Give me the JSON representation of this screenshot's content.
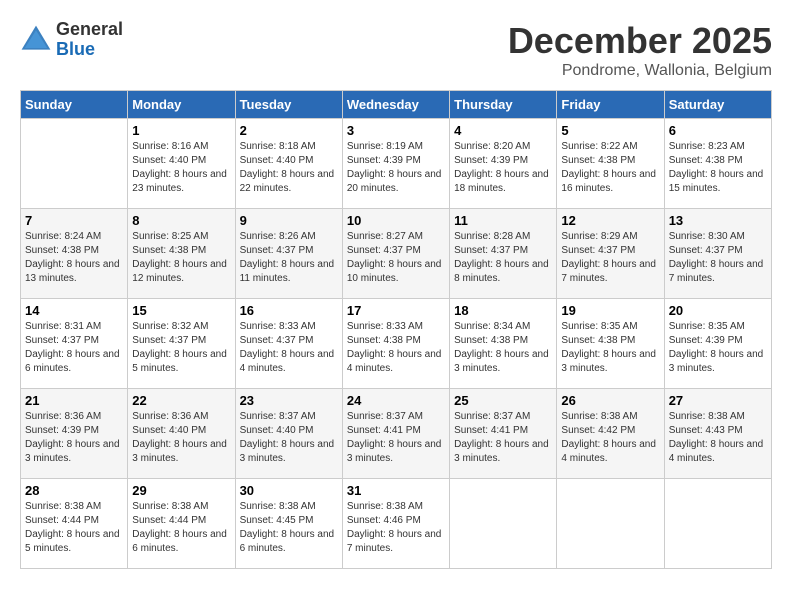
{
  "logo": {
    "general": "General",
    "blue": "Blue"
  },
  "title": {
    "month": "December 2025",
    "location": "Pondrome, Wallonia, Belgium"
  },
  "weekdays": [
    "Sunday",
    "Monday",
    "Tuesday",
    "Wednesday",
    "Thursday",
    "Friday",
    "Saturday"
  ],
  "weeks": [
    [
      {
        "day": "",
        "empty": true
      },
      {
        "day": "1",
        "sunrise": "8:16 AM",
        "sunset": "4:40 PM",
        "daylight": "8 hours and 23 minutes."
      },
      {
        "day": "2",
        "sunrise": "8:18 AM",
        "sunset": "4:40 PM",
        "daylight": "8 hours and 22 minutes."
      },
      {
        "day": "3",
        "sunrise": "8:19 AM",
        "sunset": "4:39 PM",
        "daylight": "8 hours and 20 minutes."
      },
      {
        "day": "4",
        "sunrise": "8:20 AM",
        "sunset": "4:39 PM",
        "daylight": "8 hours and 18 minutes."
      },
      {
        "day": "5",
        "sunrise": "8:22 AM",
        "sunset": "4:38 PM",
        "daylight": "8 hours and 16 minutes."
      },
      {
        "day": "6",
        "sunrise": "8:23 AM",
        "sunset": "4:38 PM",
        "daylight": "8 hours and 15 minutes."
      }
    ],
    [
      {
        "day": "7",
        "sunrise": "8:24 AM",
        "sunset": "4:38 PM",
        "daylight": "8 hours and 13 minutes."
      },
      {
        "day": "8",
        "sunrise": "8:25 AM",
        "sunset": "4:38 PM",
        "daylight": "8 hours and 12 minutes."
      },
      {
        "day": "9",
        "sunrise": "8:26 AM",
        "sunset": "4:37 PM",
        "daylight": "8 hours and 11 minutes."
      },
      {
        "day": "10",
        "sunrise": "8:27 AM",
        "sunset": "4:37 PM",
        "daylight": "8 hours and 10 minutes."
      },
      {
        "day": "11",
        "sunrise": "8:28 AM",
        "sunset": "4:37 PM",
        "daylight": "8 hours and 8 minutes."
      },
      {
        "day": "12",
        "sunrise": "8:29 AM",
        "sunset": "4:37 PM",
        "daylight": "8 hours and 7 minutes."
      },
      {
        "day": "13",
        "sunrise": "8:30 AM",
        "sunset": "4:37 PM",
        "daylight": "8 hours and 7 minutes."
      }
    ],
    [
      {
        "day": "14",
        "sunrise": "8:31 AM",
        "sunset": "4:37 PM",
        "daylight": "8 hours and 6 minutes."
      },
      {
        "day": "15",
        "sunrise": "8:32 AM",
        "sunset": "4:37 PM",
        "daylight": "8 hours and 5 minutes."
      },
      {
        "day": "16",
        "sunrise": "8:33 AM",
        "sunset": "4:37 PM",
        "daylight": "8 hours and 4 minutes."
      },
      {
        "day": "17",
        "sunrise": "8:33 AM",
        "sunset": "4:38 PM",
        "daylight": "8 hours and 4 minutes."
      },
      {
        "day": "18",
        "sunrise": "8:34 AM",
        "sunset": "4:38 PM",
        "daylight": "8 hours and 3 minutes."
      },
      {
        "day": "19",
        "sunrise": "8:35 AM",
        "sunset": "4:38 PM",
        "daylight": "8 hours and 3 minutes."
      },
      {
        "day": "20",
        "sunrise": "8:35 AM",
        "sunset": "4:39 PM",
        "daylight": "8 hours and 3 minutes."
      }
    ],
    [
      {
        "day": "21",
        "sunrise": "8:36 AM",
        "sunset": "4:39 PM",
        "daylight": "8 hours and 3 minutes."
      },
      {
        "day": "22",
        "sunrise": "8:36 AM",
        "sunset": "4:40 PM",
        "daylight": "8 hours and 3 minutes."
      },
      {
        "day": "23",
        "sunrise": "8:37 AM",
        "sunset": "4:40 PM",
        "daylight": "8 hours and 3 minutes."
      },
      {
        "day": "24",
        "sunrise": "8:37 AM",
        "sunset": "4:41 PM",
        "daylight": "8 hours and 3 minutes."
      },
      {
        "day": "25",
        "sunrise": "8:37 AM",
        "sunset": "4:41 PM",
        "daylight": "8 hours and 3 minutes."
      },
      {
        "day": "26",
        "sunrise": "8:38 AM",
        "sunset": "4:42 PM",
        "daylight": "8 hours and 4 minutes."
      },
      {
        "day": "27",
        "sunrise": "8:38 AM",
        "sunset": "4:43 PM",
        "daylight": "8 hours and 4 minutes."
      }
    ],
    [
      {
        "day": "28",
        "sunrise": "8:38 AM",
        "sunset": "4:44 PM",
        "daylight": "8 hours and 5 minutes."
      },
      {
        "day": "29",
        "sunrise": "8:38 AM",
        "sunset": "4:44 PM",
        "daylight": "8 hours and 6 minutes."
      },
      {
        "day": "30",
        "sunrise": "8:38 AM",
        "sunset": "4:45 PM",
        "daylight": "8 hours and 6 minutes."
      },
      {
        "day": "31",
        "sunrise": "8:38 AM",
        "sunset": "4:46 PM",
        "daylight": "8 hours and 7 minutes."
      },
      {
        "day": "",
        "empty": true
      },
      {
        "day": "",
        "empty": true
      },
      {
        "day": "",
        "empty": true
      }
    ]
  ]
}
